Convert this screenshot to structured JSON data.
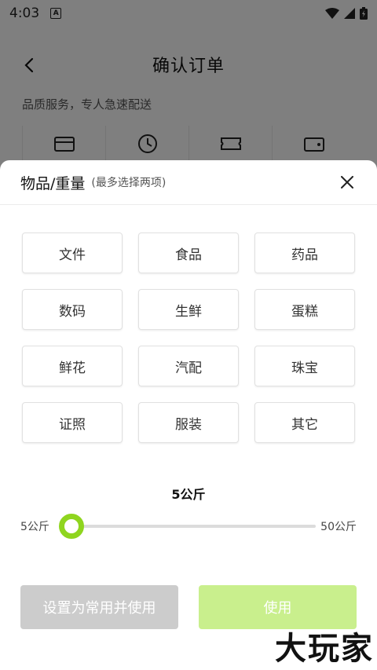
{
  "status_bar": {
    "time": "4:03",
    "a_badge": "A"
  },
  "nav": {
    "title": "确认订单"
  },
  "background": {
    "subtitle": "品质服务，专人急速配送"
  },
  "sheet": {
    "title": "物品/重量",
    "hint": "(最多选择两项)",
    "items": [
      "文件",
      "食品",
      "药品",
      "数码",
      "生鲜",
      "蛋糕",
      "鲜花",
      "汽配",
      "珠宝",
      "证照",
      "服装",
      "其它"
    ]
  },
  "weight": {
    "value_label": "5公斤",
    "min_label": "5公斤",
    "max_label": "50公斤",
    "current_fraction": 0
  },
  "buttons": {
    "save_common": "设置为常用并使用",
    "use": "使用"
  },
  "watermark": "大玩家",
  "colors": {
    "accent": "#8fd51f",
    "use_button": "#c9ef8d",
    "disabled_button": "#cccccc"
  }
}
